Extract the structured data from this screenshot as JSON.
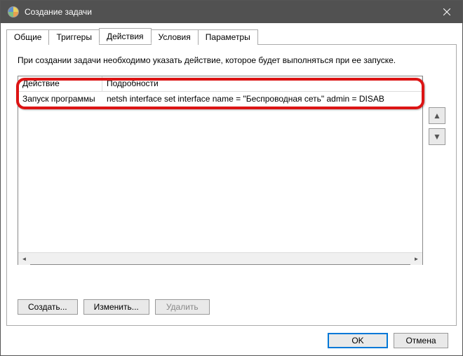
{
  "window": {
    "title": "Создание задачи"
  },
  "tabs": {
    "general": "Общие",
    "triggers": "Триггеры",
    "actions": "Действия",
    "conditions": "Условия",
    "settings": "Параметры"
  },
  "panel": {
    "description": "При создании задачи необходимо указать действие, которое будет выполняться при ее запуске.",
    "columns": {
      "action": "Действие",
      "details": "Подробности"
    },
    "rows": [
      {
        "action": "Запуск программы",
        "details": "netsh interface set interface name = \"Беспроводная сеть\" admin = DISAB"
      }
    ],
    "buttons": {
      "create": "Создать...",
      "edit": "Изменить...",
      "delete": "Удалить"
    }
  },
  "dialog": {
    "ok": "OK",
    "cancel": "Отмена"
  }
}
